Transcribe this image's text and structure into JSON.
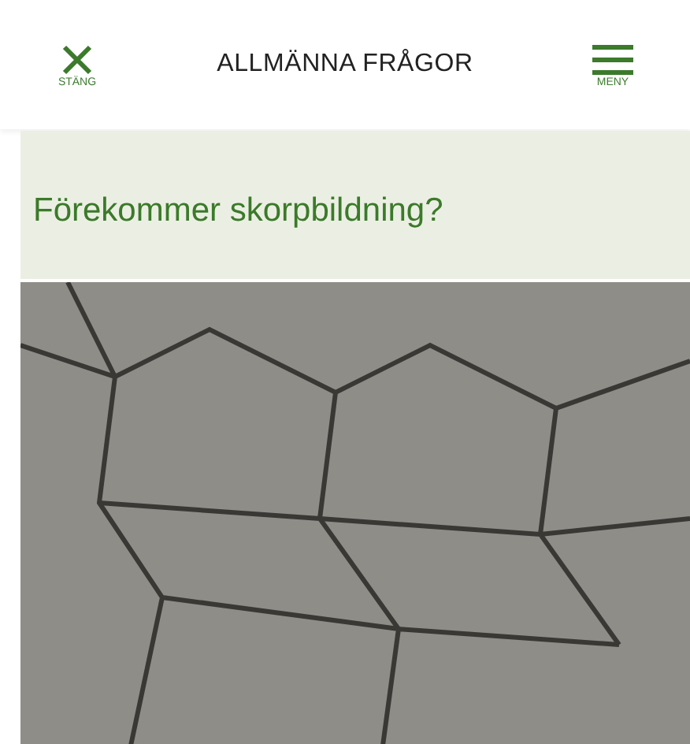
{
  "header": {
    "close_label": "STÄNG",
    "title": "ALLMÄNNA FRÅGOR",
    "menu_label": "MENY"
  },
  "question": {
    "title": "Förekommer skorpbildning?"
  }
}
